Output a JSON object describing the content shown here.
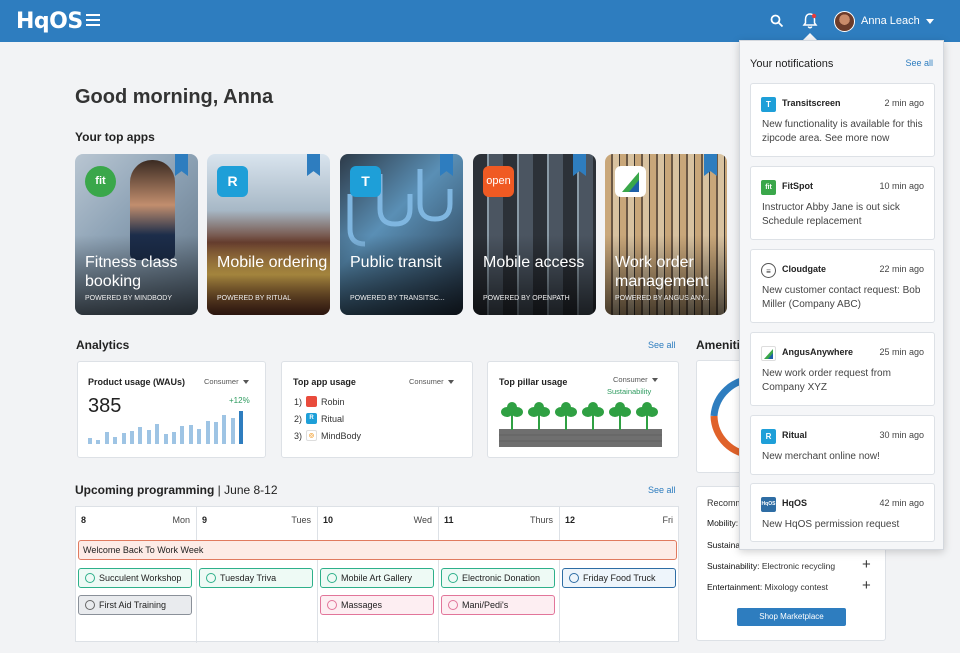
{
  "header": {
    "logo": "HqOS",
    "user_name": "Anna Leach",
    "icons": [
      "menu-icon",
      "search-icon",
      "bell-icon",
      "chevron-down-icon"
    ],
    "brand_color": "#2e7dbf"
  },
  "greeting": "Good morning, Anna",
  "top_apps": {
    "title": "Your top apps",
    "apps": [
      {
        "title": "Fitness class booking",
        "powered": "POWERED BY MINDBODY",
        "icon_text": "fit",
        "icon_color": "#3aa74a"
      },
      {
        "title": "Mobile ordering",
        "powered": "POWERED BY RITUAL",
        "icon_text": "R",
        "icon_color": "#1e9fd8"
      },
      {
        "title": "Public transit",
        "powered": "POWERED BY TRANSITSC...",
        "icon_text": "T",
        "icon_color": "#1e9fd8"
      },
      {
        "title": "Mobile access",
        "powered": "POWERED BY OPENPATH",
        "icon_text": "open",
        "icon_color": "#f05a23"
      },
      {
        "title": "Work order management",
        "powered": "POWERED BY ANGUS ANY...",
        "icon_text": "",
        "icon_color": "#ffffff"
      }
    ]
  },
  "analytics": {
    "title": "Analytics",
    "see_all": "See all",
    "product_usage": {
      "title": "Product usage (WAUs)",
      "filter": "Consumer",
      "value": "385",
      "change": "+12%",
      "bars": [
        5,
        4,
        11,
        6,
        10,
        12,
        15,
        13,
        18,
        9,
        11,
        16,
        17,
        14,
        21,
        20,
        26,
        24,
        30
      ]
    },
    "top_app_usage": {
      "title": "Top app usage",
      "filter": "Consumer",
      "items": [
        {
          "rank": "1)",
          "name": "Robin",
          "icon_color": "#e94b3c"
        },
        {
          "rank": "2)",
          "name": "Ritual",
          "icon_color": "#1e9fd8"
        },
        {
          "rank": "3)",
          "name": "MindBody",
          "icon_color": "#f2a33a"
        }
      ]
    },
    "top_pillar_usage": {
      "title": "Top pillar usage",
      "filter": "Consumer",
      "subfilter": "Sustainability"
    }
  },
  "amenities": {
    "title": "Amenities",
    "recommendations_title": "Recommendations",
    "rows": [
      {
        "category": "Mobility:",
        "detail": ""
      },
      {
        "category": "Sustainability:",
        "detail": ""
      },
      {
        "category": "Sustainability:",
        "detail": "Electronic recycling"
      },
      {
        "category": "Entertainment:",
        "detail": "Mixology contest"
      }
    ],
    "shop_button": "Shop Marketplace"
  },
  "programming": {
    "title": "Upcoming programming",
    "date_range": "June 8-12",
    "see_all": "See all",
    "days": [
      {
        "date": "8",
        "day": "Mon"
      },
      {
        "date": "9",
        "day": "Tues"
      },
      {
        "date": "10",
        "day": "Wed"
      },
      {
        "date": "11",
        "day": "Thurs"
      },
      {
        "date": "12",
        "day": "Fri"
      }
    ],
    "banner_event": "Welcome Back To Work Week",
    "events": [
      {
        "label": "Succulent Workshop"
      },
      {
        "label": "Tuesday Triva"
      },
      {
        "label": "Mobile Art Gallery"
      },
      {
        "label": "Electronic Donation"
      },
      {
        "label": "Friday Food Truck"
      },
      {
        "label": "First Aid Training"
      },
      {
        "label": "Massages"
      },
      {
        "label": "Mani/Pedi's"
      }
    ]
  },
  "notifications": {
    "title": "Your notifications",
    "see_all": "See all",
    "items": [
      {
        "app": "Transitscreen",
        "time": "2 min ago",
        "message": "New functionality is available for this zipcode area. See more now",
        "icon_text": "T",
        "icon_color": "#1e9fd8"
      },
      {
        "app": "FitSpot",
        "time": "10 min ago",
        "message": "Instructor Abby Jane is out sick Schedule replacement",
        "icon_text": "fit",
        "icon_color": "#3aa74a"
      },
      {
        "app": "Cloudgate",
        "time": "22 min ago",
        "message": "New customer contact request: Bob Miller (Company ABC)",
        "icon_text": "≡",
        "icon_color": "#ffffff"
      },
      {
        "app": "AngusAnywhere",
        "time": "25 min ago",
        "message": "New work order request from Company XYZ",
        "icon_text": "",
        "icon_color": "#ffffff"
      },
      {
        "app": "Ritual",
        "time": "30 min ago",
        "message": "New merchant online now!",
        "icon_text": "R",
        "icon_color": "#1e9fd8"
      },
      {
        "app": "HqOS",
        "time": "42 min ago",
        "message": "New HqOS permission request",
        "icon_text": "HqOS",
        "icon_color": "#2e6da4"
      }
    ]
  }
}
